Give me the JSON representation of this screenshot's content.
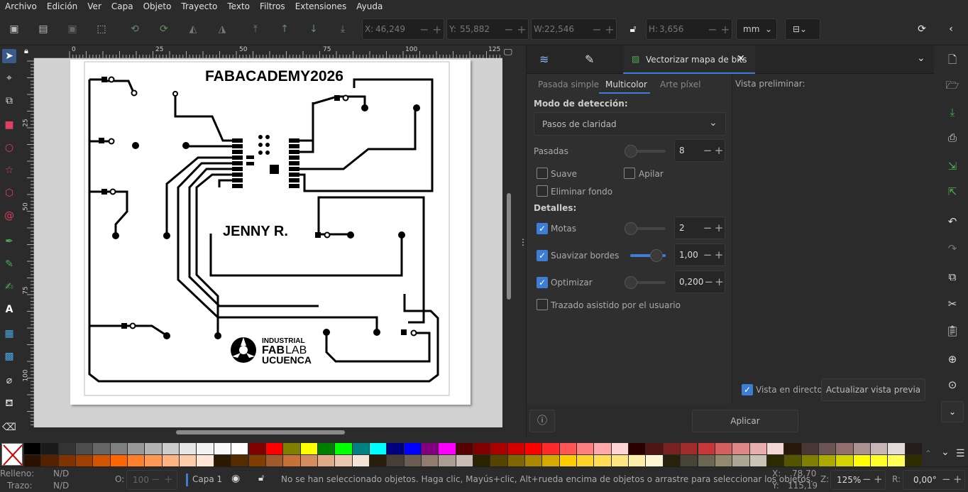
{
  "menu": [
    "Archivo",
    "Edición",
    "Ver",
    "Capa",
    "Objeto",
    "Trayecto",
    "Texto",
    "Filtros",
    "Extensiones",
    "Ayuda"
  ],
  "coords": {
    "x_label": "X:",
    "x_value": "46,249",
    "y_label": "Y:",
    "y_value": "55,882",
    "w_label": "W:",
    "w_value": "22,546",
    "h_label": "H:",
    "h_value": "3,656",
    "unit": "mm"
  },
  "ruler": {
    "h_ticks": [
      "0",
      "25",
      "50",
      "75",
      "100",
      "125"
    ],
    "v_ticks": [
      "25",
      "50",
      "75",
      "100"
    ]
  },
  "design": {
    "title": "FABACADEMY2026",
    "name": "JENNY R.",
    "logo_top": "INDUSTRIAL",
    "logo_mid_bold": "FAB",
    "logo_mid_light": "LAB",
    "logo_bottom": "UCUENCA"
  },
  "dock": {
    "active_tab": "Vectorizar mapa de bits",
    "subtabs": [
      "Pasada simple",
      "Multicolor",
      "Arte píxel"
    ],
    "active_subtab": "Multicolor",
    "detection_label": "Modo de detección:",
    "detection_value": "Pasos de claridad",
    "passes_label": "Pasadas",
    "passes_value": "8",
    "suave": "Suave",
    "apilar": "Apilar",
    "eliminar_fondo": "Eliminar fondo",
    "detalles": "Detalles:",
    "motas": "Motas",
    "motas_value": "2",
    "suavizar": "Suavizar bordes",
    "suavizar_value": "1,00",
    "optimizar": "Optimizar",
    "optimizar_value": "0,200",
    "trazado": "Trazado asistido por el usuario",
    "preview_label": "Vista preliminar:",
    "live_preview": "Vista en directo",
    "update_preview": "Actualizar vista previa",
    "apply": "Aplicar",
    "checked_color": "#3d7dd6"
  },
  "status": {
    "fill_label": "Relleno:",
    "fill_value": "N/D",
    "stroke_label": "Trazo:",
    "stroke_value": "N/D",
    "opacity_label": "O:",
    "opacity_value": "100",
    "layer": "Capa 1",
    "message": "No se han seleccionado objetos. Haga clic, Mayús+clic, Alt+rueda encima de objetos o arrastre para seleccionar los objetos.",
    "x_label": "X:",
    "x_value": "78,70",
    "y_label": "Y:",
    "y_value": "115,19",
    "zoom_label": "Z:",
    "zoom_value": "125%",
    "rot_label": "R:",
    "rot_value": "0,00°"
  },
  "palette_row1": [
    "#000000",
    "#1a1a1a",
    "#333333",
    "#4d4d4d",
    "#666666",
    "#808080",
    "#999999",
    "#b3b3b3",
    "#cccccc",
    "#e6e6e6",
    "#f2f2f2",
    "#f9f9f9",
    "#ffffff",
    "#800000",
    "#ff0000",
    "#808000",
    "#ffff00",
    "#008000",
    "#00ff00",
    "#008080",
    "#00ffff",
    "#000080",
    "#0000ff",
    "#800080",
    "#ff00ff",
    "#550000",
    "#800000",
    "#aa0000",
    "#d40000",
    "#ff0000",
    "#ff2a2a",
    "#ff5555",
    "#ff8080",
    "#ffaaaa",
    "#ffd5d5",
    "#2b0000",
    "#501616",
    "#782121",
    "#a02c2c",
    "#c83737",
    "#d35f5f",
    "#de8787",
    "#e9afaf",
    "#f4d7d7",
    "#28170b",
    "#483737",
    "#6c5353",
    "#916f6f",
    "#ac9393",
    "#c8b7b7",
    "#e3dbdb",
    "#241c1c"
  ],
  "palette_row2": [
    "#2b1100",
    "#552200",
    "#803300",
    "#a04000",
    "#d45500",
    "#ff6600",
    "#ff7f2a",
    "#ff9955",
    "#ffb380",
    "#ffccaa",
    "#ffe6d5",
    "#2b1a00",
    "#552b00",
    "#803f00",
    "#a05a2c",
    "#c87137",
    "#d38d5f",
    "#deaa87",
    "#e9c6af",
    "#f4e3d7",
    "#281e0b",
    "#483e37",
    "#6c5d53",
    "#917c6f",
    "#ac9d93",
    "#c8beb7",
    "#2b2200",
    "#554400",
    "#806600",
    "#aa8800",
    "#d4aa00",
    "#ffcc00",
    "#ffd42a",
    "#ffdd55",
    "#ffe680",
    "#ffeeaa",
    "#fff6d5",
    "#28220b",
    "#484537",
    "#6c6753",
    "#918a6f",
    "#aca793",
    "#c8c4b7",
    "#2b2b00",
    "#555500",
    "#808000",
    "#aaaa00",
    "#d4d400",
    "#ffff00",
    "#ffff2a",
    "#ffff55",
    "#2d2d00"
  ]
}
